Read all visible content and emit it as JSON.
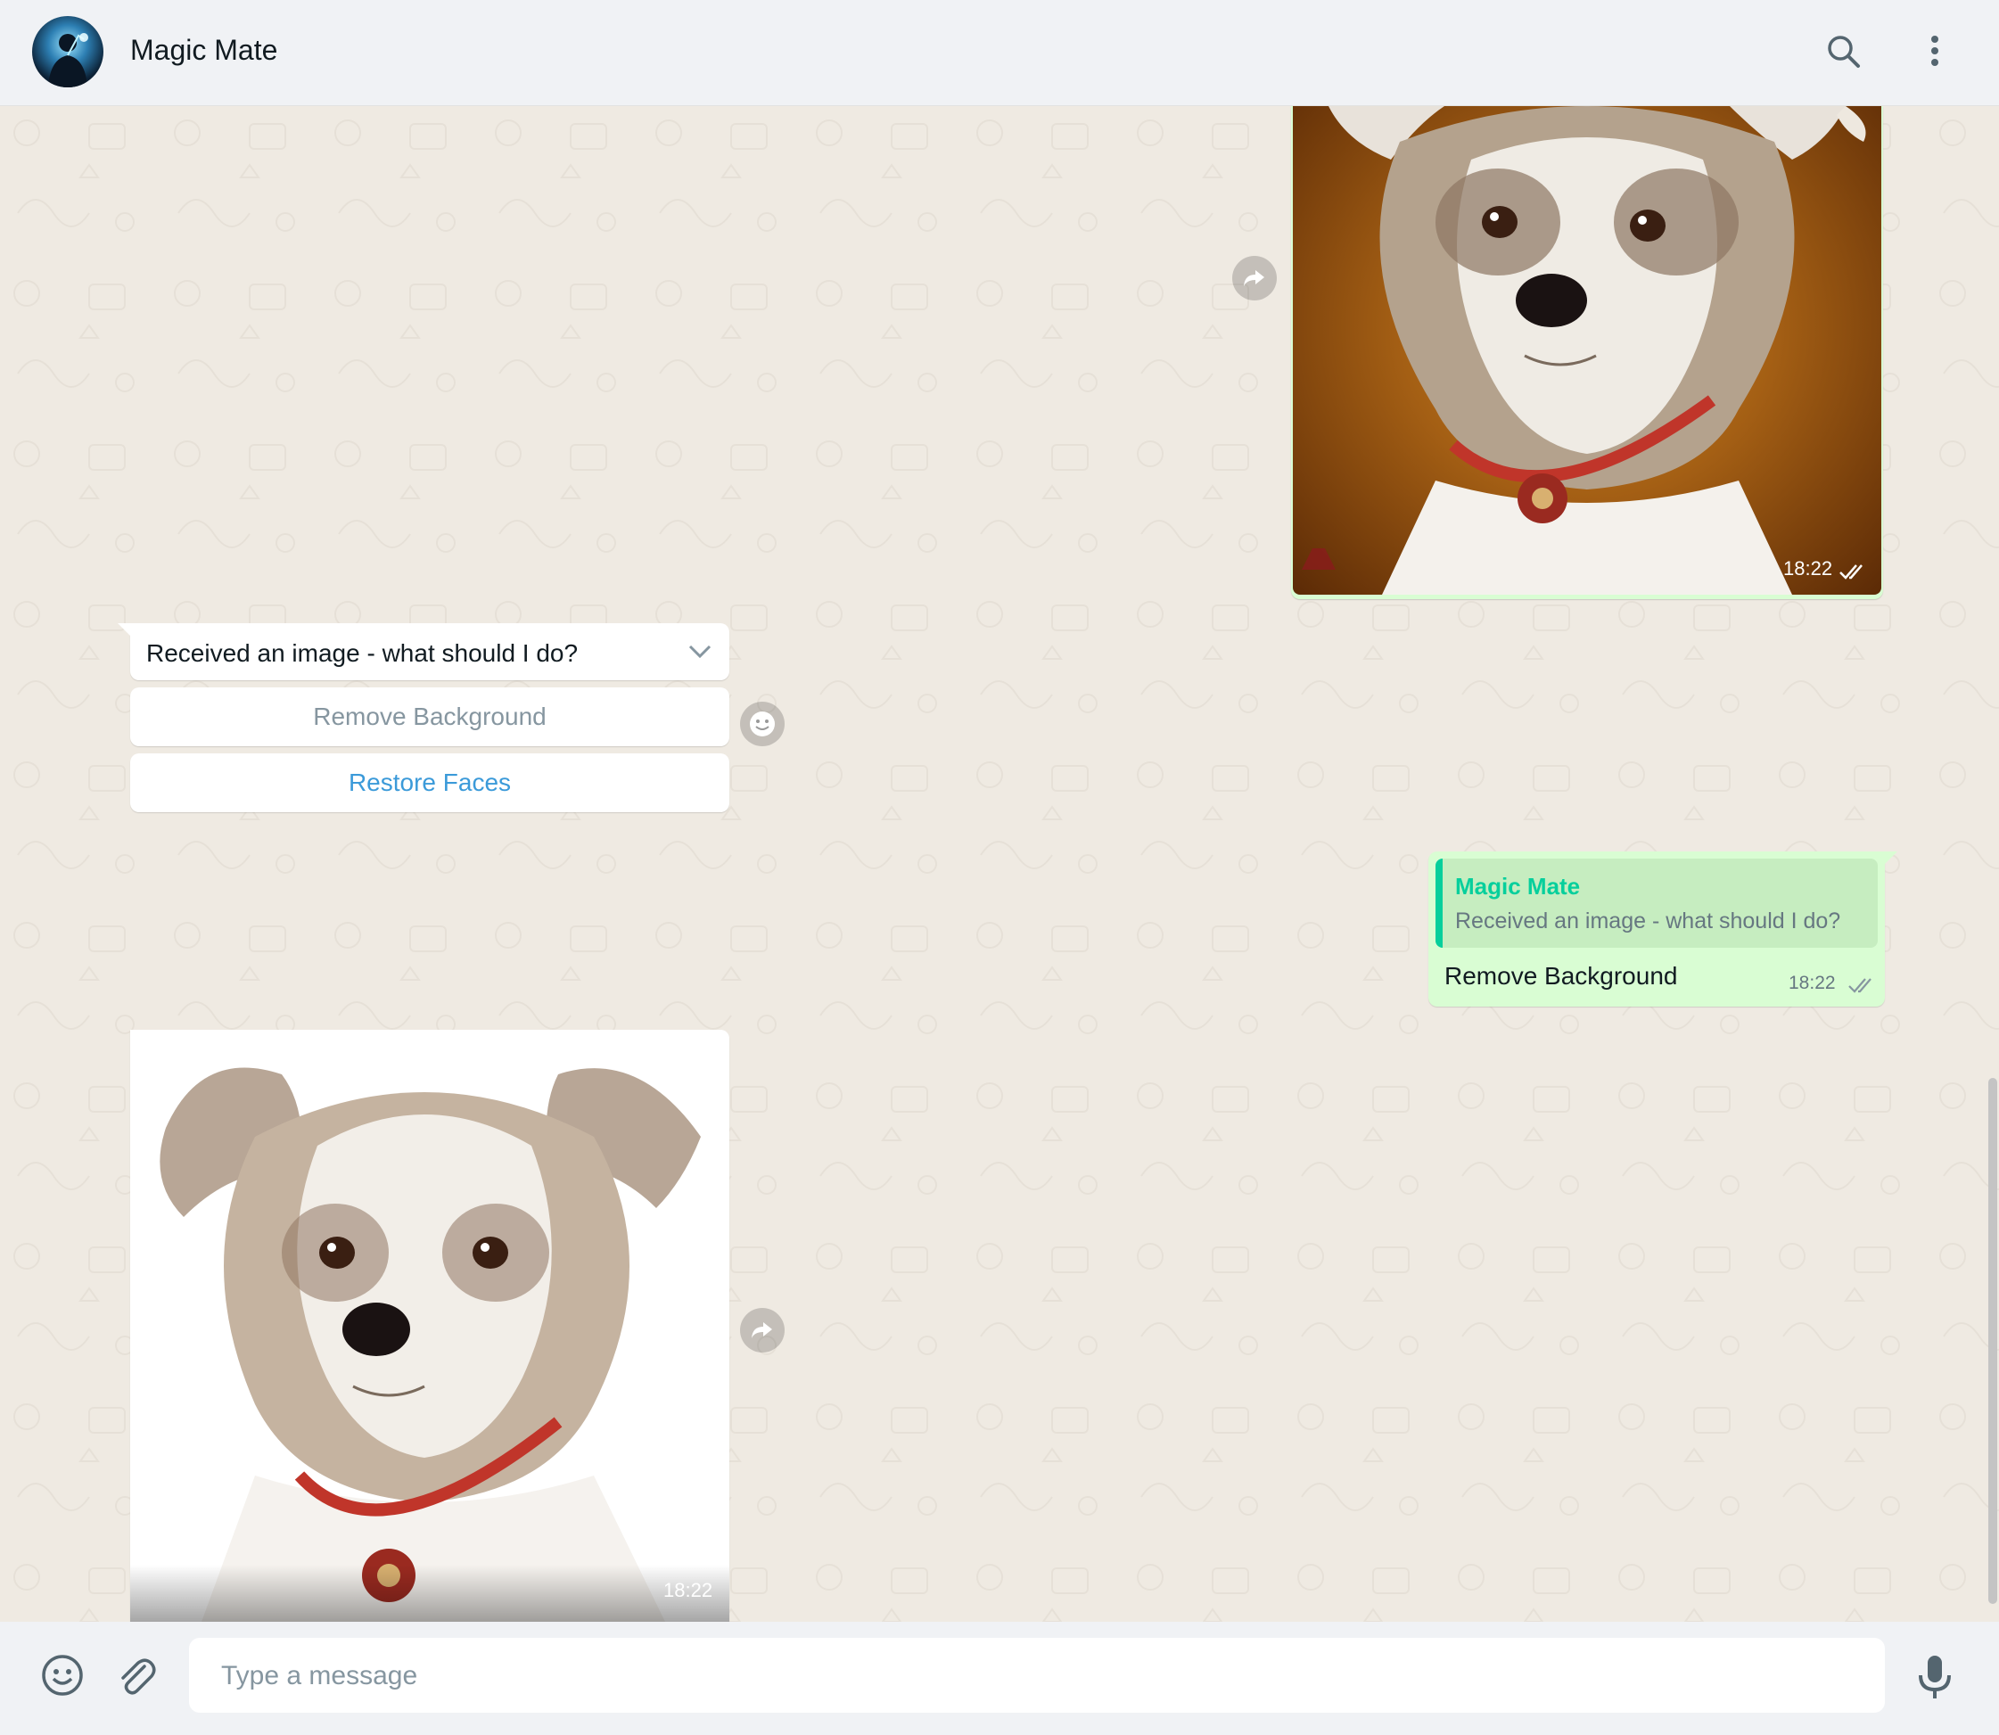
{
  "header": {
    "contact_name": "Magic Mate",
    "avatar_icon": "wizard-avatar",
    "search_icon": "search-icon",
    "menu_icon": "more-vertical-icon"
  },
  "messages": {
    "outgoing_image": {
      "time": "18:22",
      "status_icon": "double-check-icon"
    },
    "incoming_prompt": {
      "text": "Received an image - what should I do?",
      "menu_icon": "chevron-down-icon"
    },
    "quick_replies": [
      {
        "label": "Remove Background",
        "state": "disabled"
      },
      {
        "label": "Restore Faces",
        "state": "enabled"
      }
    ],
    "outgoing_reply": {
      "quoted_author": "Magic Mate",
      "quoted_text": "Received an image - what should I do?",
      "text": "Remove Background",
      "time": "18:22",
      "status_icon": "double-check-icon"
    },
    "incoming_image": {
      "time": "18:22"
    }
  },
  "composer": {
    "placeholder": "Type a message",
    "emoji_icon": "emoji-icon",
    "attach_icon": "paperclip-icon",
    "mic_icon": "microphone-icon"
  },
  "colors": {
    "outgoing_bubble": "#d9fdd3",
    "incoming_bubble": "#ffffff",
    "chat_background": "#efeae2",
    "accent_green": "#06cf9c",
    "link_blue": "#3b9ad9"
  }
}
